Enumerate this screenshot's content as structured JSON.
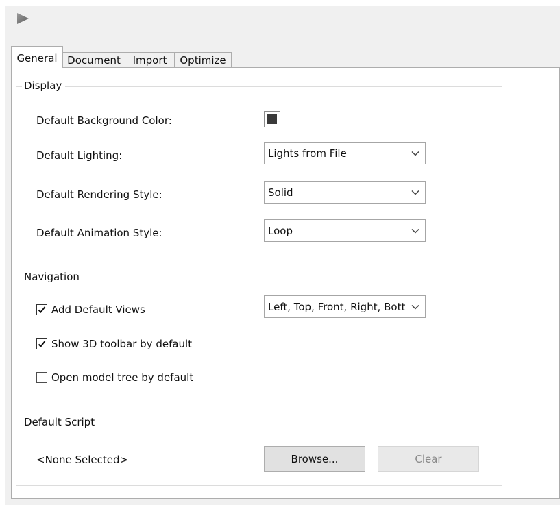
{
  "tabs": {
    "general": "General",
    "document": "Document",
    "import": "Import",
    "optimize": "Optimize"
  },
  "display": {
    "title": "Display",
    "background_color_label": "Default Background Color:",
    "background_color_value": "#3a3a3a",
    "lighting_label": "Default Lighting:",
    "lighting_value": "Lights from File",
    "rendering_label": "Default Rendering Style:",
    "rendering_value": "Solid",
    "animation_label": "Default Animation Style:",
    "animation_value": "Loop"
  },
  "navigation": {
    "title": "Navigation",
    "add_views_label": "Add Default Views",
    "add_views_checked": true,
    "views_value": "Left, Top, Front, Right, Bott",
    "toolbar_label": "Show 3D toolbar by default",
    "toolbar_checked": true,
    "model_tree_label": "Open model tree by default",
    "model_tree_checked": false
  },
  "script": {
    "title": "Default Script",
    "selected_text": "<None Selected>",
    "browse_label": "Browse...",
    "clear_label": "Clear"
  },
  "icons": {
    "header": "play-icon",
    "dropdown": "chevron-down-icon",
    "check": "checkmark-icon"
  }
}
